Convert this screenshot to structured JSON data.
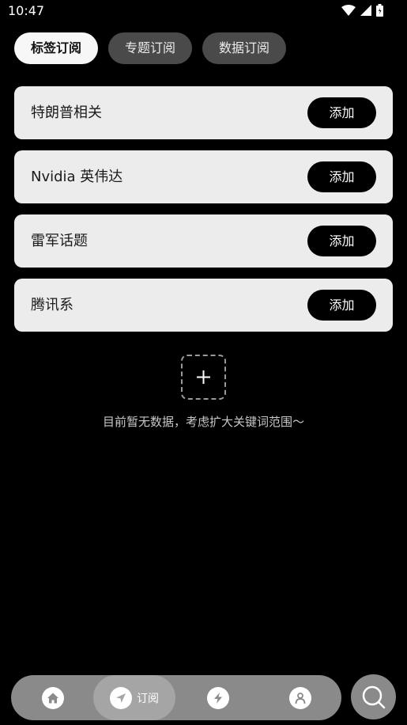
{
  "status_bar": {
    "time": "10:47",
    "icons": [
      "wifi-icon",
      "signal-icon",
      "battery-icon"
    ]
  },
  "tabs": [
    {
      "label": "标签订阅",
      "active": true
    },
    {
      "label": "专题订阅",
      "active": false
    },
    {
      "label": "数据订阅",
      "active": false
    }
  ],
  "subscriptions": [
    {
      "title": "特朗普相关",
      "button": "添加"
    },
    {
      "title": "Nvidia 英伟达",
      "button": "添加"
    },
    {
      "title": "雷军话题",
      "button": "添加"
    },
    {
      "title": "腾讯系",
      "button": "添加"
    }
  ],
  "empty_state": {
    "icon": "plus-icon",
    "hint": "目前暂无数据，考虑扩大关键词范围～"
  },
  "bottom_nav": {
    "items": [
      {
        "icon": "home-icon",
        "label": ""
      },
      {
        "icon": "send-icon",
        "label": "订阅",
        "active": true
      },
      {
        "icon": "lightning-icon",
        "label": ""
      },
      {
        "icon": "user-icon",
        "label": ""
      }
    ],
    "search_icon": "search-icon"
  },
  "colors": {
    "background": "#000000",
    "card": "#ececec",
    "nav": "#8a8a8a",
    "tab_inactive": "#4a4a4a"
  }
}
